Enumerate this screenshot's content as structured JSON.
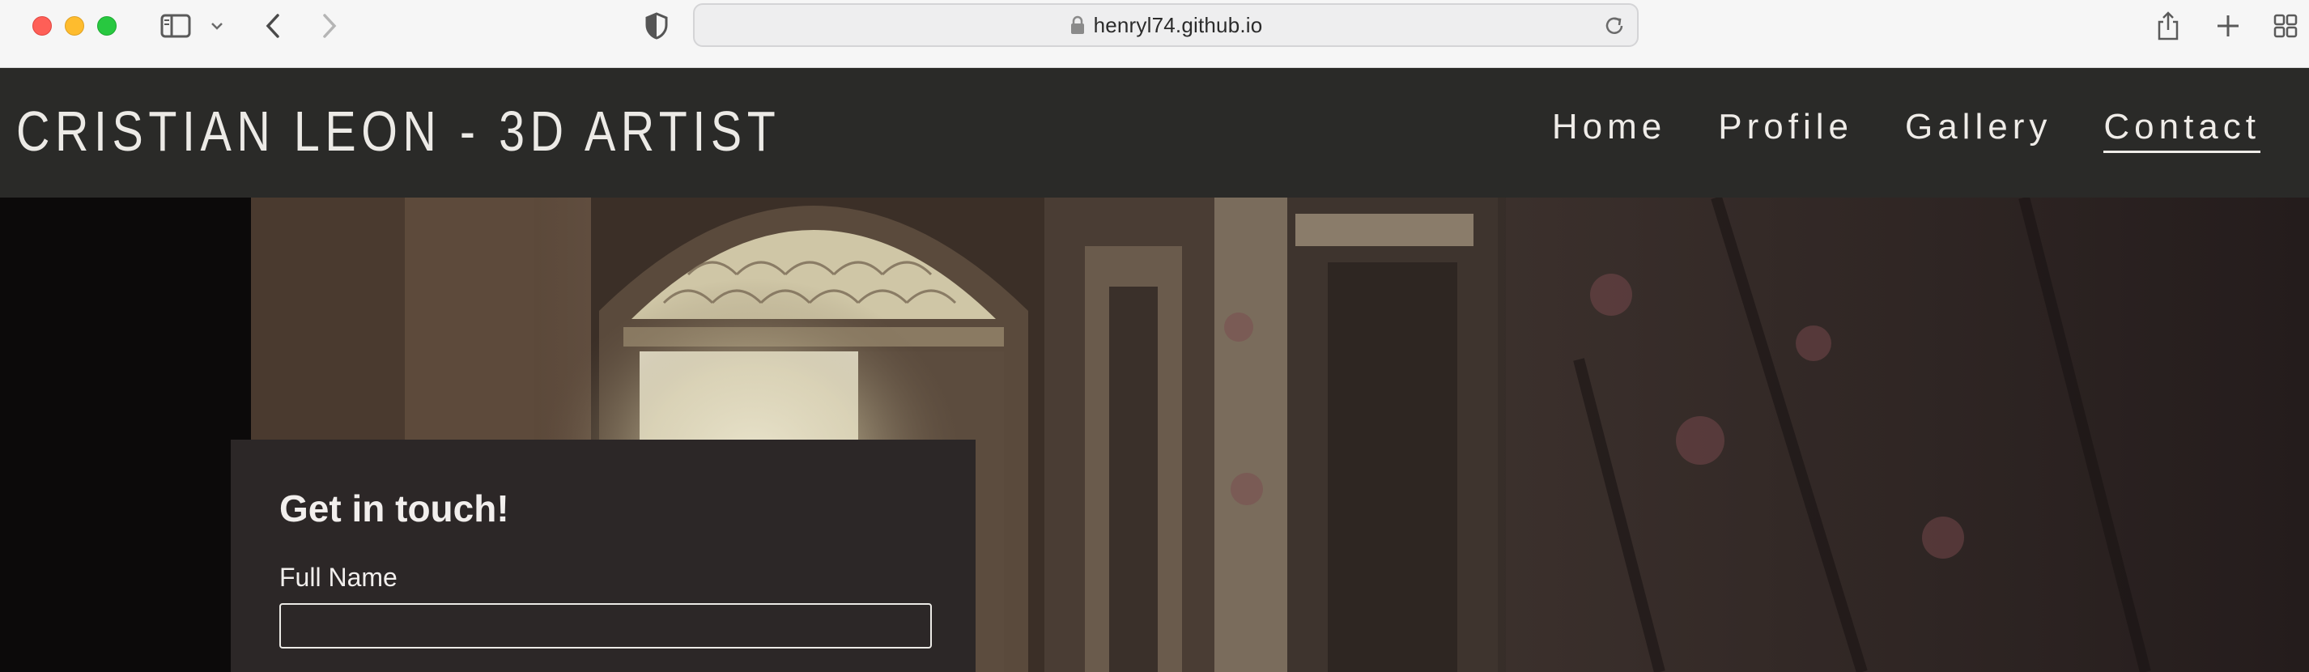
{
  "browser": {
    "url": "henryl74.github.io"
  },
  "header": {
    "site_title": "CRISTIAN LEON - 3D ARTIST",
    "nav": [
      {
        "label": "Home"
      },
      {
        "label": "Profile"
      },
      {
        "label": "Gallery"
      },
      {
        "label": "Contact",
        "active": true
      }
    ]
  },
  "form": {
    "title": "Get in touch!",
    "full_name_label": "Full Name",
    "full_name_value": ""
  },
  "colors": {
    "header_bg": "#2a2a28",
    "card_bg": "#2c2727",
    "text": "#efece8"
  }
}
